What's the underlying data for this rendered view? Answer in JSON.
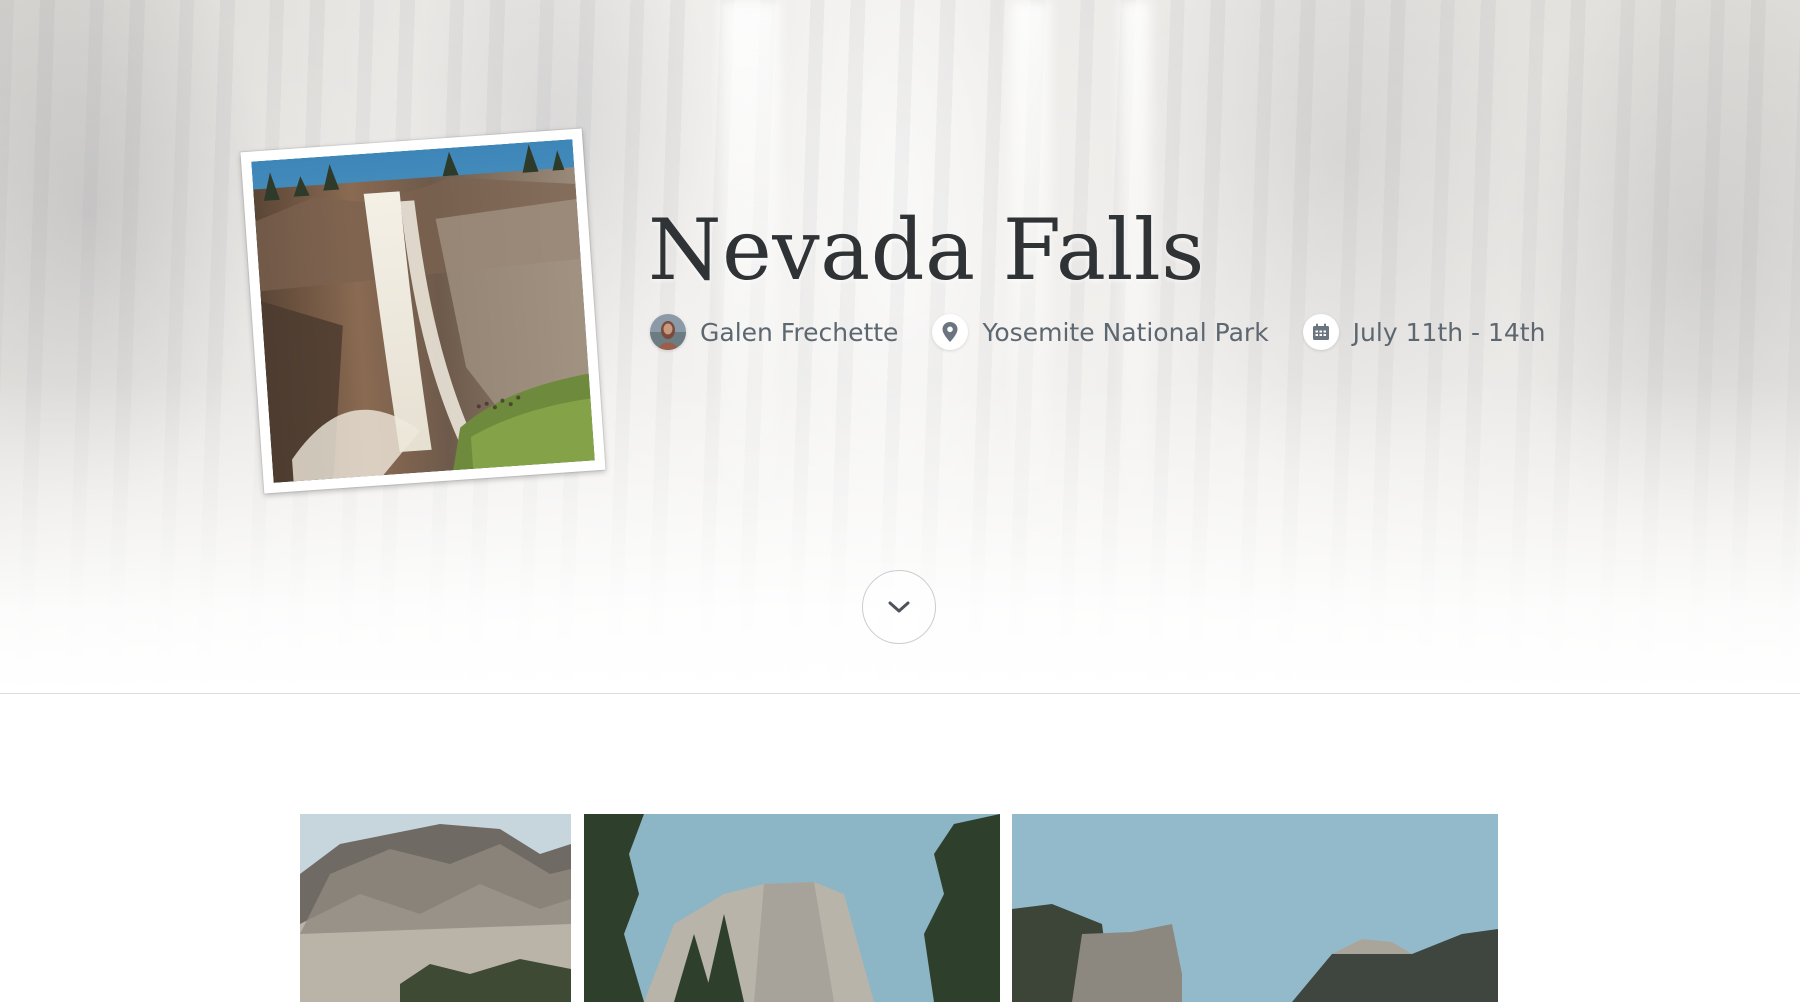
{
  "trip": {
    "title": "Nevada Falls",
    "author": "Galen Frechette",
    "location": "Yosemite National Park",
    "dates": "July 11th - 14th"
  },
  "icons": {
    "location": "map-pin-icon",
    "dates": "calendar-icon",
    "scroll": "chevron-down-icon"
  },
  "gallery": [
    {
      "name": "gallery-photo-mountain-cliffs"
    },
    {
      "name": "gallery-photo-el-capitan-trees"
    },
    {
      "name": "gallery-photo-valley-view"
    }
  ],
  "colors": {
    "title": "#2f3336",
    "meta_text": "#5d6770",
    "icon": "#6b7580"
  }
}
